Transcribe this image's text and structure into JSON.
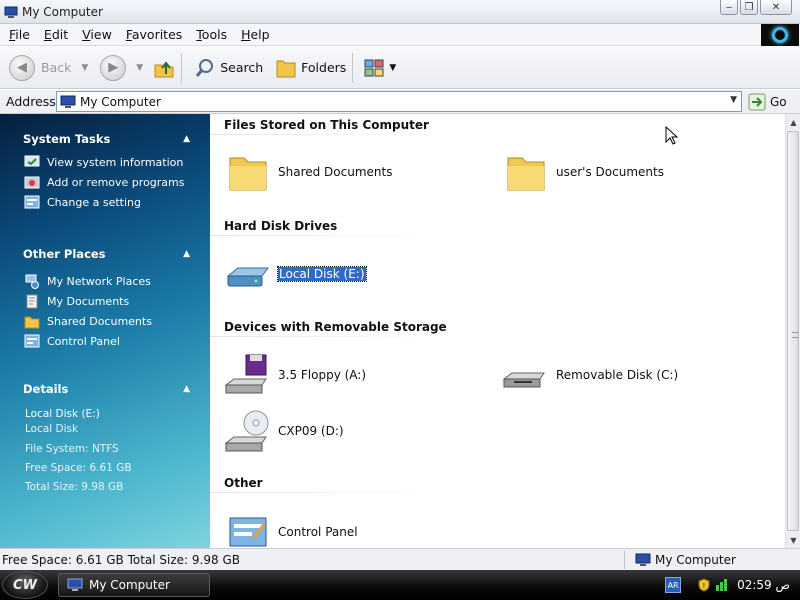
{
  "window": {
    "title": "My Computer"
  },
  "menu": {
    "items": [
      {
        "mnemonic": "F",
        "rest": "ile"
      },
      {
        "mnemonic": "E",
        "rest": "dit"
      },
      {
        "mnemonic": "V",
        "rest": "iew"
      },
      {
        "mnemonic": "F",
        "rest": "avorites"
      },
      {
        "mnemonic": "T",
        "rest": "ools"
      },
      {
        "mnemonic": "H",
        "rest": "elp"
      }
    ]
  },
  "toolbar": {
    "back_label": "Back",
    "search_label": "Search",
    "folders_label": "Folders"
  },
  "address": {
    "label": "Address",
    "value": "My Computer",
    "go_label": "Go"
  },
  "tasks": {
    "system_tasks": {
      "title": "System Tasks",
      "items": [
        "View system information",
        "Add or remove programs",
        "Change a setting"
      ]
    },
    "other_places": {
      "title": "Other Places",
      "items": [
        "My Network Places",
        "My Documents",
        "Shared Documents",
        "Control Panel"
      ]
    },
    "details": {
      "title": "Details",
      "name": "Local Disk (E:)",
      "type": "Local Disk",
      "file_system": "File System: NTFS",
      "free_space": "Free Space: 6.61 GB",
      "total_size": "Total Size: 9.98 GB"
    }
  },
  "groups": {
    "files": {
      "title": "Files Stored on This Computer",
      "items": [
        "Shared Documents",
        "user's Documents"
      ]
    },
    "hdd": {
      "title": "Hard Disk Drives",
      "items": [
        "Local Disk (E:)"
      ]
    },
    "removable": {
      "title": "Devices with Removable Storage",
      "items": [
        "3.5 Floppy (A:)",
        "Removable Disk (C:)",
        "CXP09 (D:)"
      ]
    },
    "other": {
      "title": "Other",
      "items": [
        "Control Panel"
      ]
    }
  },
  "status": {
    "left": "Free Space: 6.61 GB Total Size: 9.98 GB",
    "right": "My Computer"
  },
  "taskbar": {
    "start_label": "CW",
    "task_item": "My Computer",
    "lang": "AR",
    "clock": "02:59 ص"
  },
  "colors": {
    "selection": "#316ac5",
    "pane_dark": "#06203e",
    "pane_light": "#7dd3de"
  }
}
